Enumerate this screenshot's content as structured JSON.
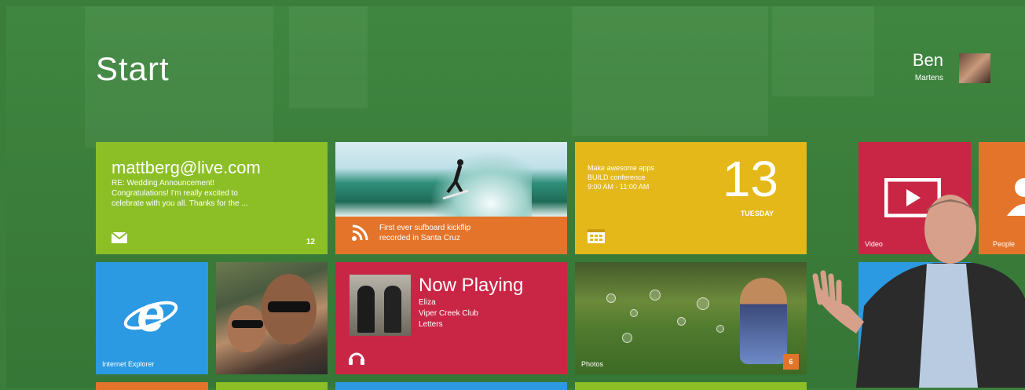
{
  "start": {
    "title": "Start"
  },
  "user": {
    "first_name": "Ben",
    "last_name": "Martens"
  },
  "tiles": {
    "mail": {
      "address": "mattberg@live.com",
      "subject": "RE: Wedding Announcement!",
      "preview_line1": "Congratulations! I'm really excited to",
      "preview_line2": "celebrate with you all. Thanks for the ...",
      "count": "12",
      "icon": "envelope-icon"
    },
    "news": {
      "line1": "First ever sufboard kickflip",
      "line2": "recorded in Santa Cruz",
      "icon": "rss-icon"
    },
    "calendar": {
      "line1": "Make awesome apps",
      "line2": "BUILD conference",
      "line3": "9:00 AM - 11:00 AM",
      "day": "13",
      "weekday": "TUESDAY",
      "icon": "calendar-icon"
    },
    "video": {
      "label": "Video",
      "icon": "play-icon"
    },
    "people": {
      "label": "People",
      "icon": "person-icon"
    },
    "ie": {
      "label": "Internet Explorer",
      "icon": "internet-explorer-icon"
    },
    "music": {
      "title": "Now Playing",
      "artist": "Eliza",
      "album": "Viper Creek Club",
      "track": "Letters",
      "icon": "headphones-icon"
    },
    "photos": {
      "label": "Photos",
      "count": "6"
    }
  },
  "colors": {
    "background": "#3b7d3a",
    "green": "#8cbf26",
    "orange": "#e4742a",
    "yellow": "#e4b819",
    "crimson": "#c92646",
    "blue": "#2b9ae3"
  }
}
